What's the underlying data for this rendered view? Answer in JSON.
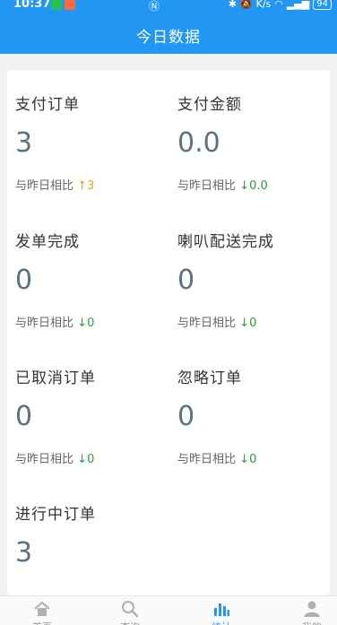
{
  "status_bar": {
    "time": "10:37",
    "battery": "94",
    "network_speed": "K/s"
  },
  "header": {
    "title": "今日数据"
  },
  "stats": [
    {
      "label": "支付订单",
      "value": "3",
      "compare_label": "与昨日相比",
      "trend_icon": "↑",
      "trend_value": "3",
      "direction": "up"
    },
    {
      "label": "支付金额",
      "value": "0.0",
      "compare_label": "与昨日相比",
      "trend_icon": "↓",
      "trend_value": "0.0",
      "direction": "down"
    },
    {
      "label": "发单完成",
      "value": "0",
      "compare_label": "与昨日相比",
      "trend_icon": "↓",
      "trend_value": "0",
      "direction": "down"
    },
    {
      "label": "喇叭配送完成",
      "value": "0",
      "compare_label": "与昨日相比",
      "trend_icon": "↓",
      "trend_value": "0",
      "direction": "down"
    },
    {
      "label": "已取消订单",
      "value": "0",
      "compare_label": "与昨日相比",
      "trend_icon": "↓",
      "trend_value": "0",
      "direction": "down"
    },
    {
      "label": "忽略订单",
      "value": "0",
      "compare_label": "与昨日相比",
      "trend_icon": "↓",
      "trend_value": "0",
      "direction": "down"
    },
    {
      "label": "进行中订单",
      "value": "3"
    }
  ],
  "tabs": [
    {
      "label": "首页",
      "icon": "home-icon"
    },
    {
      "label": "查询",
      "icon": "search-icon"
    },
    {
      "label": "统计",
      "icon": "bar-chart-icon",
      "active": true
    },
    {
      "label": "我的",
      "icon": "user-icon"
    }
  ],
  "colors": {
    "primary": "#2196f3",
    "up": "#f0a020",
    "down": "#2e9b46",
    "value": "#5a7280"
  }
}
